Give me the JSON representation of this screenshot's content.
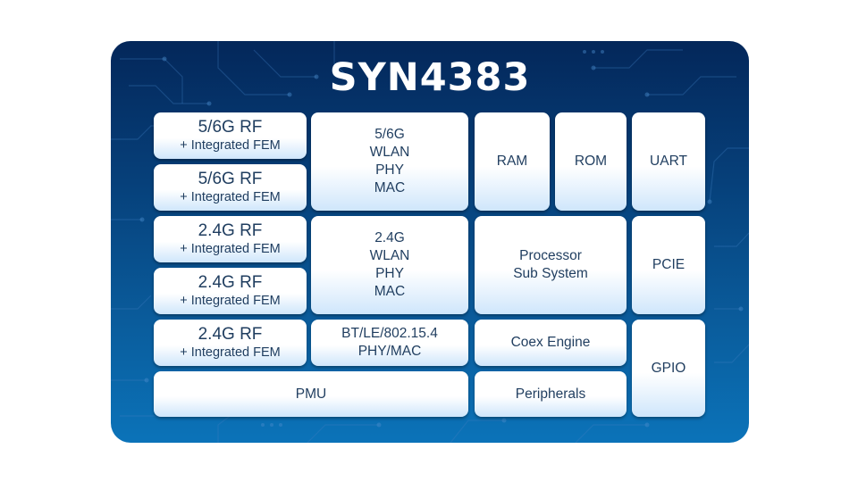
{
  "title": "SYN4383",
  "colors": {
    "card_top": "#04275a",
    "card_bottom": "#0b73b9",
    "block_text": "#1f3d5f",
    "block_fill": "#ffffff",
    "block_fill_bottom": "#cfe6fb",
    "title_text": "#ffffff"
  },
  "rf_blocks": [
    {
      "main": "5/6G RF",
      "sub": "+ Integrated FEM"
    },
    {
      "main": "5/6G RF",
      "sub": "+ Integrated FEM"
    },
    {
      "main": "2.4G RF",
      "sub": "+ Integrated FEM"
    },
    {
      "main": "2.4G RF",
      "sub": "+ Integrated FEM"
    },
    {
      "main": "2.4G RF",
      "sub": "+ Integrated FEM"
    }
  ],
  "wlan_5g": [
    "5/6G",
    "WLAN",
    "PHY",
    "MAC"
  ],
  "wlan_24g": [
    "2.4G",
    "WLAN",
    "PHY",
    "MAC"
  ],
  "bt": [
    "BT/LE/802.15.4",
    "PHY/MAC"
  ],
  "pmu": "PMU",
  "ram": "RAM",
  "rom": "ROM",
  "uart": "UART",
  "processor": [
    "Processor",
    "Sub System"
  ],
  "pcie": "PCIE",
  "coex": "Coex Engine",
  "peripherals": "Peripherals",
  "gpio": "GPIO"
}
